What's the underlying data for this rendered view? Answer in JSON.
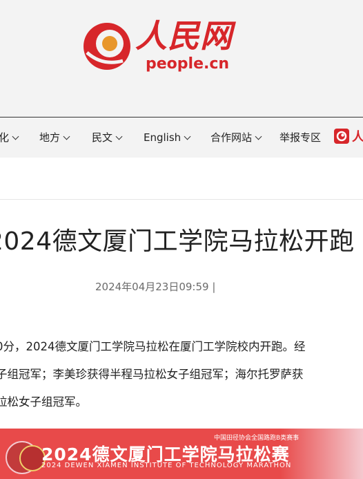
{
  "logo": {
    "chinese": "人民网",
    "english": "people.cn"
  },
  "nav": {
    "items": [
      {
        "label": "化",
        "has_dropdown": true
      },
      {
        "label": "地方",
        "has_dropdown": true
      },
      {
        "label": "民文",
        "has_dropdown": true
      },
      {
        "label": "English",
        "has_dropdown": true
      },
      {
        "label": "合作网站",
        "has_dropdown": true
      },
      {
        "label": "举报专区",
        "has_dropdown": false
      }
    ],
    "partial_logo_text": "人"
  },
  "article": {
    "headline": "2024德文厦门工学院马拉松开跑",
    "datetime": "2024年04月23日09:59 |",
    "paragraph_lines": [
      "0分，2024德文厦门工学院马拉松在厦门工学院校内开跑。经",
      "子组冠军；李美珍获得半程马拉松女子组冠军；海尔托罗萨获",
      "拉松女子组冠军。"
    ]
  },
  "banner": {
    "top_text": "中国田径协会全国路跑B类赛事",
    "title": "2024德文厦门工学院马拉松赛",
    "subtitle": "2024 DEWEN XIAMEN INSTITUTE OF TECHNOLOGY MARATHON"
  },
  "colors": {
    "brand_red": "#d7262a",
    "header_bg": "#f3f3f3",
    "banner_red": "#e84a4a"
  }
}
